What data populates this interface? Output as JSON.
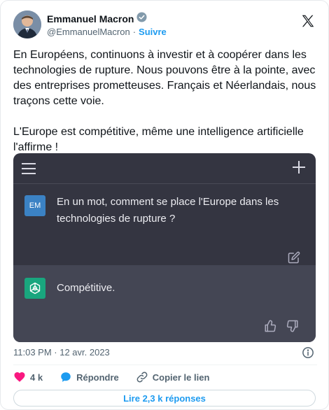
{
  "author": {
    "name": "Emmanuel Macron",
    "handle": "@EmmanuelMacron",
    "separator": "·",
    "follow_label": "Suivre",
    "verified": true
  },
  "tweet": {
    "text": "En Européens, continuons à investir et à coopérer dans les technologies de rupture. Nous pouvons être à la pointe, avec des entreprises prometteuses. Français et Néerlandais, nous traçons cette voie.\n\nL'Europe est compétitive, même une intelligence artificielle l'affirme !"
  },
  "media": {
    "user_initials": "EM",
    "user_message": "En un mot, comment se place l'Europe dans les technologies de rupture ?",
    "assistant_message": "Compétitive."
  },
  "meta": {
    "timestamp": "11:03 PM · 12 avr. 2023"
  },
  "actions": {
    "likes": "4 k",
    "reply_label": "Répondre",
    "copy_link_label": "Copier le lien"
  },
  "replies_button": "Lire 2,3 k réponses",
  "colors": {
    "brand_blue": "#1d9bf0",
    "like_red": "#f91880",
    "chat_dark": "#343541",
    "chat_assistant": "#444654",
    "gpt_green": "#19a67e"
  }
}
